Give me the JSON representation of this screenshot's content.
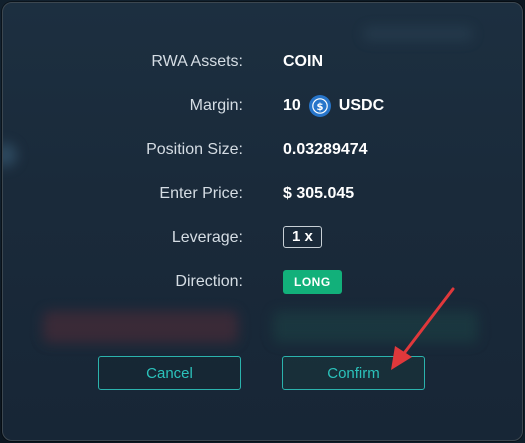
{
  "dialog": {
    "rows": [
      {
        "label": "RWA Assets:",
        "value": "COIN"
      },
      {
        "label": "Margin:",
        "amount": "10",
        "icon": "usdc-coin-icon",
        "currency": "USDC"
      },
      {
        "label": "Position Size:",
        "value": "0.03289474"
      },
      {
        "label": "Enter Price:",
        "value": "$ 305.045"
      },
      {
        "label": "Leverage:",
        "value": "1 x"
      },
      {
        "label": "Direction:",
        "value": "LONG"
      }
    ],
    "buttons": {
      "cancel": "Cancel",
      "confirm": "Confirm"
    }
  },
  "colors": {
    "accent": "#2bb3ad",
    "long": "#12b07a",
    "usdc": "#2775ca",
    "annotation_arrow": "#e0383b"
  }
}
